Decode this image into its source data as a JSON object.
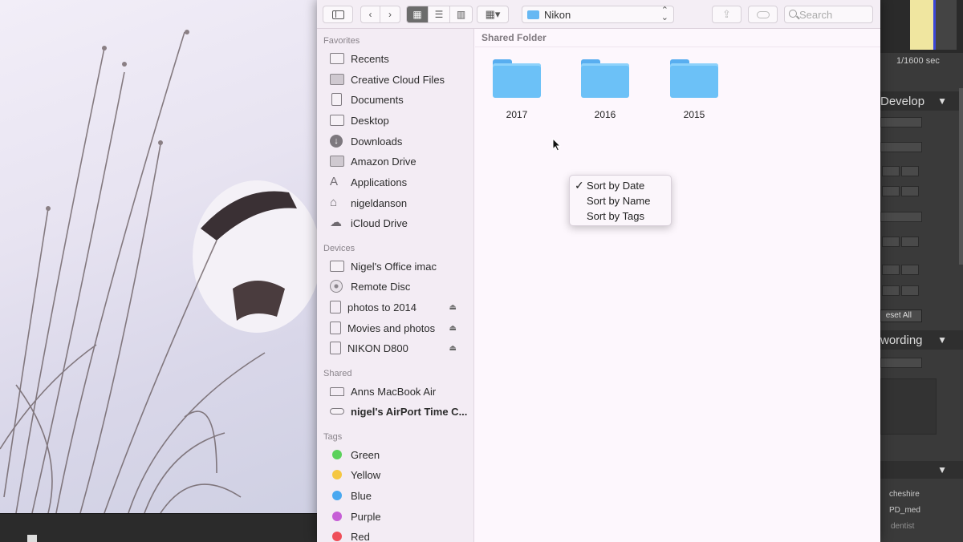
{
  "toolbar": {
    "view_modes": [
      "icon-view",
      "list-view",
      "column-view"
    ],
    "arrange_label": "arrange",
    "path": "Nikon",
    "search_placeholder": "Search"
  },
  "sidebar": {
    "favorites_header": "Favorites",
    "favorites": [
      {
        "label": "Recents",
        "icon": "recents-icon"
      },
      {
        "label": "Creative Cloud Files",
        "icon": "folder-icon"
      },
      {
        "label": "Documents",
        "icon": "documents-icon"
      },
      {
        "label": "Desktop",
        "icon": "desktop-icon"
      },
      {
        "label": "Downloads",
        "icon": "downloads-icon"
      },
      {
        "label": "Amazon Drive",
        "icon": "folder-icon"
      },
      {
        "label": "Applications",
        "icon": "applications-icon"
      },
      {
        "label": "nigeldanson",
        "icon": "home-icon"
      },
      {
        "label": "iCloud Drive",
        "icon": "cloud-icon"
      }
    ],
    "devices_header": "Devices",
    "devices": [
      {
        "label": "Nigel's Office imac",
        "icon": "imac-icon",
        "eject": false
      },
      {
        "label": "Remote Disc",
        "icon": "disc-icon",
        "eject": false
      },
      {
        "label": "photos to 2014",
        "icon": "drive-icon",
        "eject": true
      },
      {
        "label": "Movies and photos",
        "icon": "drive-icon",
        "eject": true
      },
      {
        "label": "NIKON D800",
        "icon": "drive-icon",
        "eject": true
      }
    ],
    "shared_header": "Shared",
    "shared": [
      {
        "label": "Anns MacBook Air",
        "icon": "laptop-icon"
      },
      {
        "label": "nigel's AirPort Time C...",
        "icon": "airport-icon"
      }
    ],
    "tags_header": "Tags",
    "tags": [
      {
        "label": "Green",
        "color": "#5bd15b"
      },
      {
        "label": "Yellow",
        "color": "#f5c742"
      },
      {
        "label": "Blue",
        "color": "#49a8f0"
      },
      {
        "label": "Purple",
        "color": "#c65fd6"
      },
      {
        "label": "Red",
        "color": "#ef4f59"
      }
    ]
  },
  "content": {
    "header": "Shared Folder",
    "folders": [
      "2017",
      "2016",
      "2015"
    ]
  },
  "context_menu": {
    "items": [
      {
        "label": "Sort by Date",
        "checked": true
      },
      {
        "label": "Sort by Name",
        "checked": false
      },
      {
        "label": "Sort by Tags",
        "checked": false
      }
    ]
  },
  "lightroom": {
    "shutter": "1/1600 sec",
    "develop": "Develop",
    "keywording": "wording",
    "reset_all": "eset All",
    "keywords": [
      "cheshire",
      "PD_med",
      "dentist"
    ]
  }
}
